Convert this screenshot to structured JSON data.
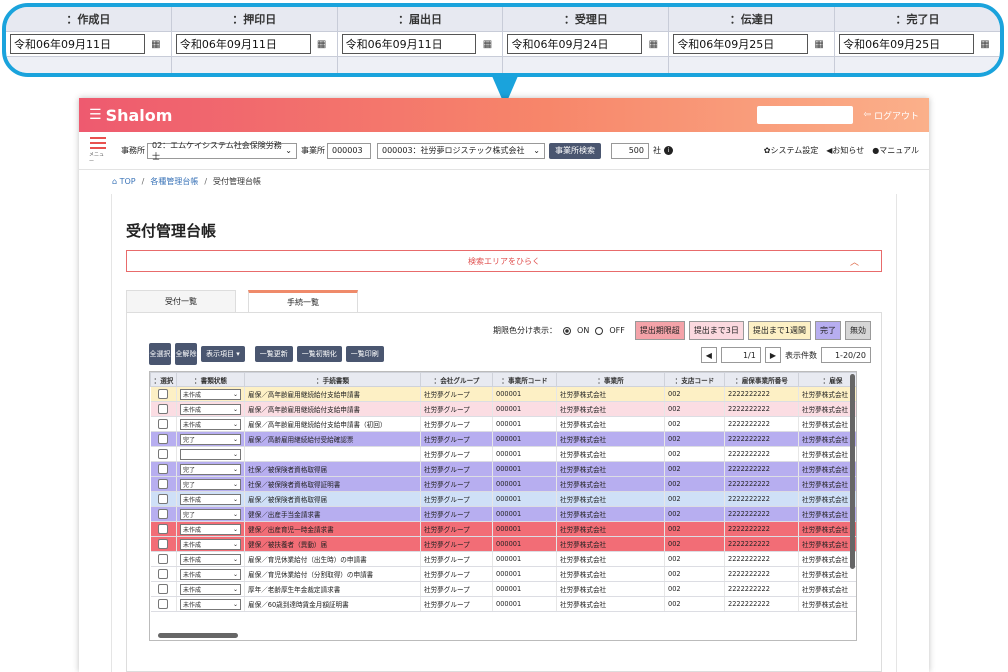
{
  "zoom": {
    "columns": [
      {
        "header": "：作成日",
        "date": "令和06年09月11日"
      },
      {
        "header": "：押印日",
        "date": "令和06年09月11日"
      },
      {
        "header": "：届出日",
        "date": "令和06年09月11日"
      },
      {
        "header": "：受理日",
        "date": "令和06年09月24日"
      },
      {
        "header": "：伝達日",
        "date": "令和06年09月25日"
      },
      {
        "header": "：完了日",
        "date": "令和06年09月25日"
      }
    ],
    "calendar_icon": "calendar-icon"
  },
  "header": {
    "logo_text": "Shalom",
    "logout_label": "ログアウト"
  },
  "subbar": {
    "menu_label": "メニュー",
    "office_label": "事務所",
    "office_value": "02：エムケイシステム社会保険労務士",
    "site_label": "事業所",
    "site_code": "000003",
    "site_value": "000003：社労夢ロジステック株式会社",
    "site_search_button": "事業所検索",
    "count_value": "500",
    "count_unit": "社",
    "system_settings": "システム設定",
    "notice": "お知らせ",
    "manual": "マニュアル"
  },
  "breadcrumb": {
    "top": "TOP",
    "mid": "各種管理台帳",
    "current": "受付管理台帳"
  },
  "page_title": "受付管理台帳",
  "search_area_label": "検索エリアをひらく",
  "tabs": [
    {
      "label": "受付一覧"
    },
    {
      "label": "手続一覧"
    }
  ],
  "legend": {
    "label": "期限色分け表示：",
    "on": "ON",
    "off": "OFF",
    "chips": [
      {
        "label": "提出期限超",
        "color": "#f4a3a9"
      },
      {
        "label": "提出まで3日",
        "color": "#fbd9df"
      },
      {
        "label": "提出まで1週間",
        "color": "#fdf0c5"
      },
      {
        "label": "完了",
        "color": "#b7aef0"
      },
      {
        "label": "無効",
        "color": "#d6d6d6"
      }
    ]
  },
  "toolbar": {
    "select_all": "全選択",
    "deselect_all": "全解除",
    "display_items": "表示項目",
    "refresh": "一覧更新",
    "reset": "一覧初期化",
    "print": "一覧印刷"
  },
  "pager": {
    "page": "1/1",
    "count_label": "表示件数",
    "count_value": "1-20/20"
  },
  "table": {
    "headers": [
      "：選択",
      "：書類状態",
      "：手続書類",
      "：会社グループ",
      "：事業所コード",
      "：事業所",
      "：支店コード",
      "：雇保事業所番号",
      "：雇保"
    ],
    "rows": [
      {
        "status": "未作成",
        "doc": "雇保／高年齢雇用継続給付支給申請書",
        "color": "#fdf0c5"
      },
      {
        "status": "未作成",
        "doc": "雇保／高年齢雇用継続給付支給申請書",
        "color": "#fbdde3"
      },
      {
        "status": "未作成",
        "doc": "雇保／高年齢雇用継続給付支給申請書（初回）",
        "color": "#ffffff"
      },
      {
        "status": "完了",
        "doc": "雇保／高齢雇用継続給付受給確認票",
        "color": "#b7aef0"
      },
      {
        "status": "",
        "doc": "",
        "color": "#ffffff"
      },
      {
        "status": "完了",
        "doc": "社保／被保険者資格取得届",
        "color": "#b7aef0"
      },
      {
        "status": "完了",
        "doc": "社保／被保険者資格取得証明書",
        "color": "#b7aef0"
      },
      {
        "status": "未作成",
        "doc": "雇保／被保険者資格取得届",
        "color": "#cfe0f7"
      },
      {
        "status": "完了",
        "doc": "健保／出産手当金請求書",
        "color": "#b7aef0"
      },
      {
        "status": "未作成",
        "doc": "健保／出産育児一時金請求書",
        "color": "#f26d76"
      },
      {
        "status": "未作成",
        "doc": "健保／被扶養者（異動）届",
        "color": "#f26d76"
      },
      {
        "status": "未作成",
        "doc": "雇保／育児休業給付（出生時）の申請書",
        "color": "#ffffff"
      },
      {
        "status": "未作成",
        "doc": "雇保／育児休業給付（分割取得）の申請書",
        "color": "#ffffff"
      },
      {
        "status": "未作成",
        "doc": "厚年／老齢厚生年金裁定請求書",
        "color": "#ffffff"
      },
      {
        "status": "未作成",
        "doc": "雇保／60歳到達時賃金月額証明書",
        "color": "#ffffff"
      }
    ],
    "group": "社労夢グループ",
    "site_code": "000001",
    "site": "社労夢株式会社",
    "branch_code": "002",
    "emp_no": "2222222222",
    "emp_col": "社労夢株式会社"
  }
}
